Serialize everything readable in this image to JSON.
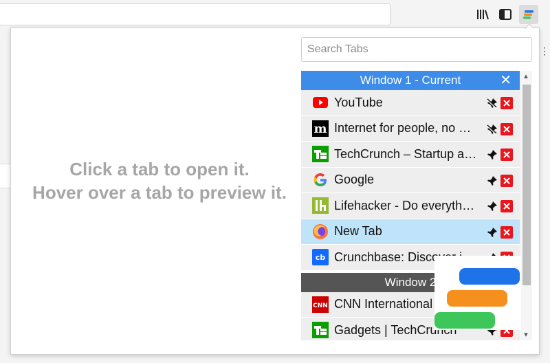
{
  "toolbar": {
    "library_icon": "library-icon",
    "sidebar_icon": "sidebar-icon",
    "extension_icon": "tab-manager-icon"
  },
  "hint": {
    "line1": "Click a tab to open it.",
    "line2": "Hover over a tab to preview it."
  },
  "search": {
    "placeholder": "Search Tabs",
    "value": ""
  },
  "windows": [
    {
      "label": "Window 1 - Current",
      "tabs": [
        {
          "title": "YouTube",
          "icon": "youtube-icon",
          "pin_state": "unpin"
        },
        {
          "title": "Internet for people, no profit — Mozilla",
          "icon": "mozilla-icon",
          "pin_state": "unpin"
        },
        {
          "title": "TechCrunch – Startup and Technology News",
          "icon": "techcrunch-icon",
          "pin_state": "pin"
        },
        {
          "title": "Google",
          "icon": "google-icon",
          "pin_state": "pin"
        },
        {
          "title": "Lifehacker - Do everything better",
          "icon": "lifehacker-icon",
          "pin_state": "pin"
        },
        {
          "title": "New Tab",
          "icon": "firefox-icon",
          "pin_state": "pin",
          "active": true
        },
        {
          "title": "Crunchbase: Discover innovative companies",
          "icon": "crunchbase-icon",
          "pin_state": "pin"
        }
      ]
    },
    {
      "label": "Window 2",
      "tabs": [
        {
          "title": "CNN International",
          "icon": "cnn-icon",
          "pin_state": "pin"
        },
        {
          "title": "Gadgets | TechCrunch",
          "icon": "techcrunch-icon",
          "pin_state": "pin"
        }
      ]
    }
  ],
  "colors": {
    "accent": "#3d8ce8",
    "close": "#e8171e",
    "active_row": "#bfe3f8",
    "window_header_other": "#555555",
    "logo_blue": "#1e73e8",
    "logo_orange": "#f5901e",
    "logo_green": "#3dc75a"
  },
  "icons": {
    "window_close": "✕",
    "scroll_up": "▴",
    "scroll_down": "▾"
  }
}
